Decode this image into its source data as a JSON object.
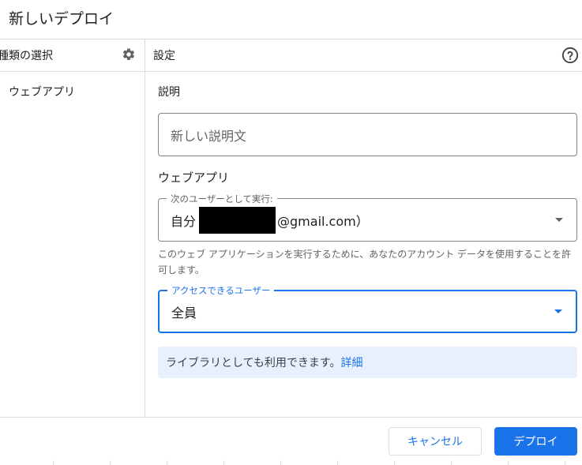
{
  "dialog": {
    "title": "新しいデプロイ"
  },
  "left_panel": {
    "header_label": "種類の選択",
    "settings_icon": "gear-icon",
    "types": [
      {
        "label": "ウェブアプリ"
      }
    ]
  },
  "right_panel": {
    "header_label": "設定",
    "help_icon": "help-circle-icon",
    "description": {
      "section_label": "説明",
      "placeholder": "新しい説明文"
    },
    "webapp": {
      "section_label": "ウェブアプリ",
      "execute_as": {
        "label": "次のユーザーとして実行:",
        "value_prefix": "自分",
        "value_suffix": "@gmail.com）"
      },
      "execute_as_helper": "このウェブ アプリケーションを実行するために、あなたのアカウント データを使用することを許可します。",
      "access": {
        "label": "アクセスできるユーザー",
        "value": "全員"
      }
    },
    "library_notice": {
      "text": "ライブラリとしても利用できます。",
      "link": "詳細"
    }
  },
  "footer": {
    "cancel_label": "キャンセル",
    "deploy_label": "デプロイ"
  },
  "colors": {
    "accent": "#1a73e8",
    "border": "#dadce0",
    "info_bg": "#e8f0fe"
  }
}
